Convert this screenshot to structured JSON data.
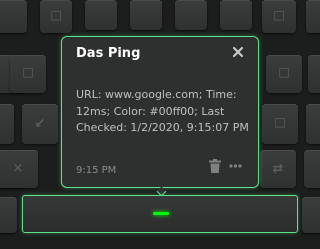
{
  "popup": {
    "title": "Das Ping",
    "body": "URL: www.google.com; Time: 12ms; Color: #00ff00; Last Checked: 1/2/2020, 9:15:07 PM",
    "timestamp": "9:15 PM",
    "close_icon": "close-icon",
    "delete_icon": "trash-icon",
    "more_icon": "more-icon"
  },
  "ping_key": {
    "led_color": "#00ff00"
  },
  "colors": {
    "accent": "#5fe089",
    "background": "#1c1d1d",
    "key": "#353737"
  }
}
